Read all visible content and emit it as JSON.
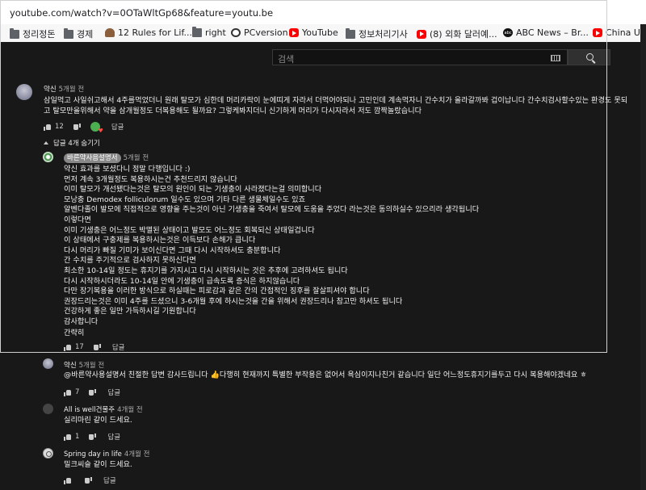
{
  "browser": {
    "url": "youtube.com/watch?v=0OTaWltGp68&feature=youtu.be",
    "bookmarks": [
      {
        "label": "정리정돈",
        "icon": "folder-icon"
      },
      {
        "label": "경제",
        "icon": "folder-icon"
      },
      {
        "label": "12 Rules for Lif...",
        "icon": "person-icon"
      },
      {
        "label": "right",
        "icon": "folder-icon"
      },
      {
        "label": "PCversion",
        "icon": "pcversion-icon"
      },
      {
        "label": "YouTube",
        "icon": "youtube-icon"
      },
      {
        "label": "정보처리기사",
        "icon": "folder-icon"
      },
      {
        "label": "(8) 외화 달러예...",
        "icon": "youtube-icon"
      },
      {
        "label": "ABC News – Br...",
        "icon": "abc-icon"
      },
      {
        "label": "China Uncen",
        "icon": "youtube-icon"
      }
    ]
  },
  "search": {
    "placeholder": "검색"
  },
  "comments": [
    {
      "author": "약신",
      "time": "5개월 전",
      "lines": [
        "삼일먹고 사일쉬고해서 4주를먹었더니 원래 탈모가  심한데 머리카락이 눈에띠게 자라서 더먹어야되나 고민인데 계속먹자니 간수치가 올라갈까봐 겁이납니다 간수치검사할수있는 환경도 못되",
        "고 탈모만을위해서 약을 삼개월정도 더복용해도 될까요? 그렇케봐지더니 신기하게 머리가 다시자라서 저도 깜짝놀랐습니다"
      ],
      "likes": "12",
      "reply": "답글"
    },
    {
      "author": "바른약사음설명서",
      "time": "5개월 전",
      "lines": [
        "약신 효과를 보셨다니 정말 다행입니다 :)",
        "먼저 계속 3개월정도 복용하시는건 추천드리지 않습니다",
        "이미 탈모가 개선됐다는것은 탈모의 원인이 되는 기생충이 사라졌다는걸 의미합니다",
        "모낭충 Demodex folliculorum 일수도 있으며 기타 다른 생물체일수도 있죠",
        "알벤다졸이 발모에 직접적으로 영향을 주는것이 아닌 기생충을 죽여서 탈모에 도움을 주었다 라는것은 동의하실수 있으리라 생각됩니다",
        "이렇다면",
        "이미 기생충은 어느정도 박멸된 상태이고 발모도 어느정도 회복되신 상태일겁니다",
        "이 상태에서 구충제를 복용하시는것은 이득보다 손해가 큽니다",
        "다시 머리가 빠질 기미가 보이신다면 그때 다시 시작하셔도 충분합니다",
        "간 수치를 주기적으로 검사하지 못하신다면",
        "최소한 10-14일 정도는 휴지기를 가지시고 다시 시작하시는 것은 추후에 고려하셔도 됩니다",
        "다시 시작하시더라도 10-14일 안에 기생충이 급속도록 증식은 하지않습니다",
        "다만 장기복용을 이러한 방식으로 하실때는 피로감과 같은 간의 간접적인 징후를 잘살피셔야 합니다",
        "권장드리는것은 이미 4주를 드셨으니 3-6개월 후에 하시는것을 간을 위해서 권장드리나 참고만 하셔도 됩니다",
        "건강하게 좋은 일만 가득하시길 기원합니다",
        "감사합니다",
        "간략히"
      ],
      "likes": "17",
      "reply": "답글"
    },
    {
      "author": "약신",
      "time": "5개월 전",
      "lines": [
        "@바른약사용설명서 친절한 답변 감사드립니다 👍다행히  현재까지 특별한 부작용은 없어서 욕심이지나친거 같습니다 일단 어느정도휴지기를두고 다시 복용해야겠네요 ㅎ"
      ],
      "likes": "7",
      "reply": "답글"
    },
    {
      "author": "All is well건물주",
      "time": "4개월 전",
      "lines": [
        "실리마린 같이 드세요."
      ],
      "likes": "1",
      "reply": "답글"
    },
    {
      "author": "Spring day in life",
      "time": "4개월 전",
      "lines": [
        "밀크씨슬 같이 드세요."
      ],
      "likes": "",
      "reply": "답글"
    }
  ],
  "replies_toggle": "답글 4개 숨기기"
}
